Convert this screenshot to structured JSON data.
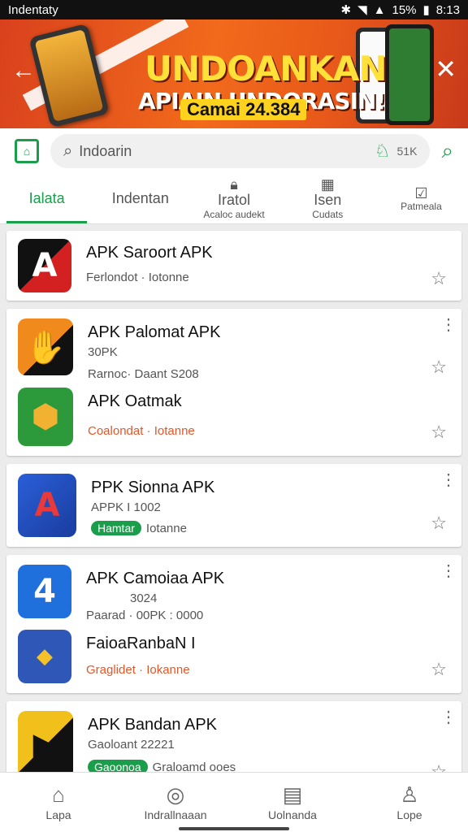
{
  "status_bar": {
    "carrier": "Indentaty",
    "battery": "15%",
    "time": "8:13"
  },
  "banner": {
    "headline": "UNDOANKAN",
    "subheadline": "APIAIN UNDORASIN!",
    "tagline": "Camai 24.384"
  },
  "search": {
    "placeholder": "Indoarin",
    "count": "51K"
  },
  "tabs": [
    {
      "label": "Ialata",
      "sub": "",
      "icon": ""
    },
    {
      "label": "Indentan",
      "sub": "",
      "icon": ""
    },
    {
      "label": "Iratol",
      "sub": "Acaloc audekt",
      "icon": "lock-icon"
    },
    {
      "label": "Isen",
      "sub": "Cudats",
      "icon": "grid-icon"
    },
    {
      "label": "",
      "sub": "Patmeala",
      "icon": "checkbox-icon"
    }
  ],
  "apps": [
    {
      "title": "APK Saroort APK",
      "meta": "Ferlondot · Iotonne"
    },
    {
      "title": "APK Palomat APK",
      "line2": "30PK",
      "meta": "Rarnoc· Daant S208"
    },
    {
      "title": "APK Oatmak",
      "meta": "Coalondat · Iotanne"
    },
    {
      "title": "PPK Sionna APK",
      "line2": "APPK I 1002",
      "badge": "Hamtar",
      "meta": "Iotanne"
    },
    {
      "title": "APK Camoiaa APK",
      "line2": "3024",
      "meta": "Paarad · 00PK : 0000"
    },
    {
      "title": "FaioaRanbaN I",
      "meta": "Graglidet · Iokanne"
    },
    {
      "title": "APK Bandan APK",
      "line2": "Gaoloant 22221",
      "badge": "Gaoonoa",
      "meta": "Graloamd ooes"
    }
  ],
  "bottom_nav": [
    {
      "label": "Lapa",
      "icon": "home-icon"
    },
    {
      "label": "Indrallnaaan",
      "icon": "compass-icon"
    },
    {
      "label": "Uolnanda",
      "icon": "download-icon"
    },
    {
      "label": "Lope",
      "icon": "person-icon"
    }
  ],
  "colors": {
    "accent": "#1b9e4b",
    "banner": "#f26a1b",
    "orange_text": "#e2572a"
  }
}
